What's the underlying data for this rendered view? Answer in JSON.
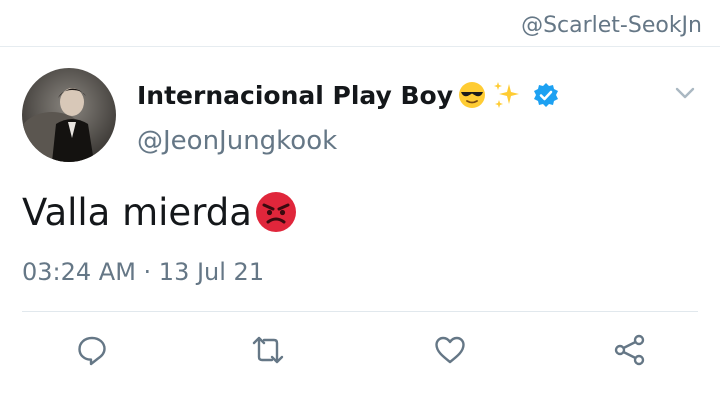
{
  "watermark": "@Scarlet-SeokJn",
  "tweet": {
    "display_name": "Internacional Play Boy",
    "handle": "@JeonJungkook",
    "text": "Valla mierda",
    "timestamp": "03:24 AM · 13 Jul 21"
  },
  "icons": {
    "name_emojis": [
      "sunglasses-face-icon",
      "sparkles-icon"
    ],
    "verified": "verified-badge-icon",
    "text_emoji": "angry-face-icon",
    "actions": [
      "reply-icon",
      "retweet-icon",
      "like-icon",
      "share-icon"
    ]
  },
  "colors": {
    "accent": "#1da1f2",
    "secondary_text": "#657786",
    "icon_gray": "#657786"
  }
}
